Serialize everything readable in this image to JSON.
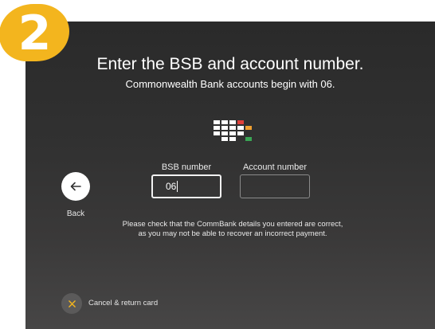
{
  "step": {
    "number": "2",
    "color": "#f3b51e"
  },
  "header": {
    "title": "Enter the BSB and account number.",
    "subtitle": "Commonwealth Bank accounts begin with 06."
  },
  "icons": {
    "keypad": "keypad-icon",
    "back": "arrow-left-icon",
    "cancel": "close-icon"
  },
  "navigation": {
    "back_label": "Back"
  },
  "form": {
    "bsb": {
      "label": "BSB number",
      "value": "06",
      "focused": true
    },
    "account": {
      "label": "Account number",
      "value": ""
    }
  },
  "notice": {
    "line1": "Please check that the CommBank details you entered are correct,",
    "line2": "as you may not be able to recover an incorrect payment."
  },
  "footer": {
    "cancel_label": "Cancel & return card"
  },
  "colors": {
    "accent": "#f3b51e",
    "keypad_red": "#e0403a",
    "keypad_orange": "#f0a030",
    "keypad_green": "#3aa655"
  }
}
